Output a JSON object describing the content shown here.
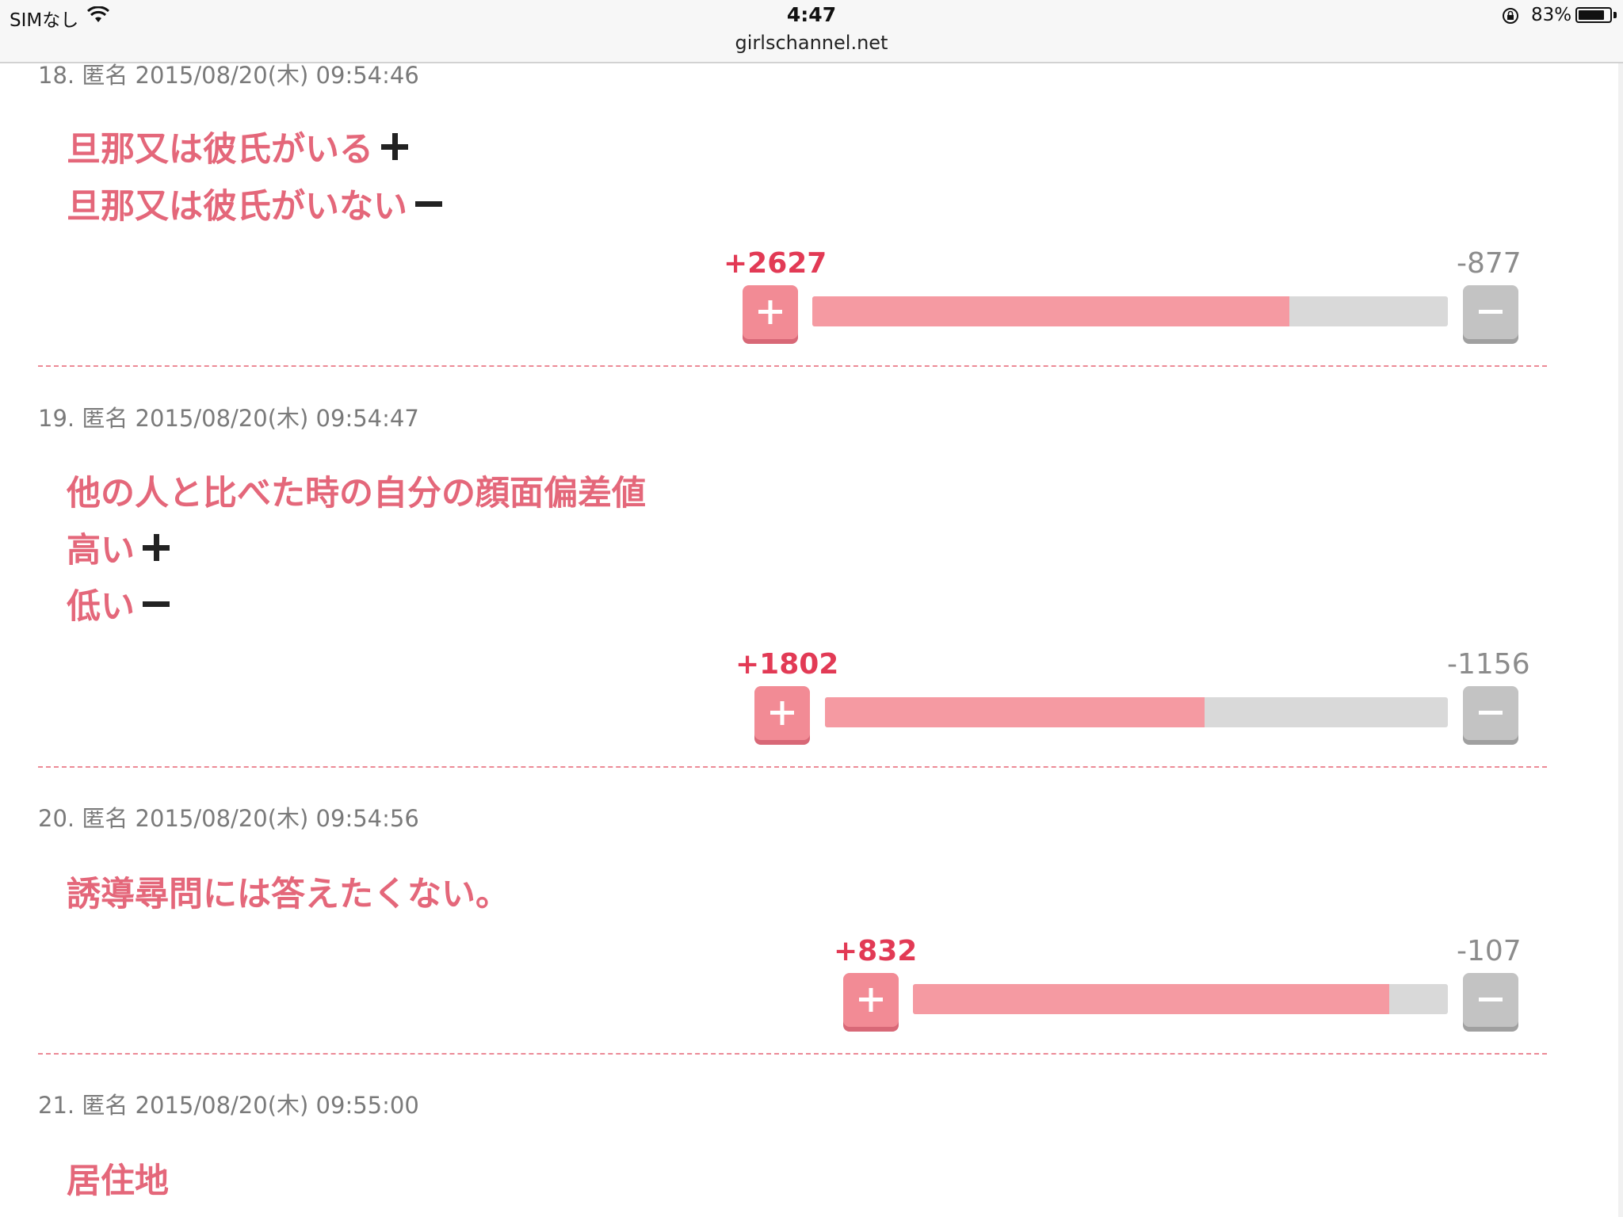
{
  "statusbar": {
    "carrier": "SIMなし",
    "time": "4:47",
    "url": "girlschannel.net",
    "battery_pct": "83%",
    "battery_level": 0.83
  },
  "comments": [
    {
      "meta": "18. 匿名 2015/08/20(木) 09:54:46",
      "lines": [
        {
          "text": "旦那又は彼氏がいる",
          "symbol": "plus"
        },
        {
          "text": "旦那又は彼氏がいない",
          "symbol": "minus"
        }
      ],
      "plus": "+2627",
      "minus": "-877",
      "ratio": 0.75
    },
    {
      "meta": "19. 匿名 2015/08/20(木) 09:54:47",
      "lines": [
        {
          "text": "他の人と比べた時の自分の顔面偏差値",
          "symbol": ""
        },
        {
          "text": "高い",
          "symbol": "plus"
        },
        {
          "text": "低い",
          "symbol": "minus"
        }
      ],
      "plus": "+1802",
      "minus": "-1156",
      "ratio": 0.61
    },
    {
      "meta": "20. 匿名 2015/08/20(木) 09:54:56",
      "lines": [
        {
          "text": "誘導尋問には答えたくない。",
          "symbol": ""
        }
      ],
      "plus": "+832",
      "minus": "-107",
      "ratio": 0.89
    },
    {
      "meta": "21. 匿名 2015/08/20(木) 09:55:00",
      "lines": [
        {
          "text": "居住地",
          "symbol": ""
        }
      ]
    }
  ]
}
